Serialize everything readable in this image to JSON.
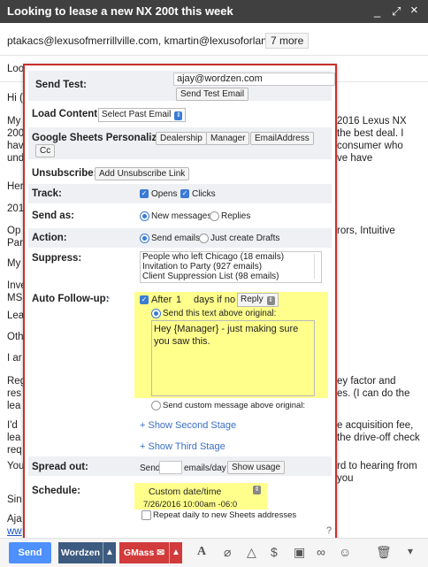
{
  "window": {
    "title": "Looking to lease a new NX 200t this week",
    "minimize": "_",
    "popout": "⤢",
    "close": "×"
  },
  "recipients": {
    "to": "ptakacs@lexusofmerrillville.com, kmartin@lexusoforland.com",
    "more": "7 more"
  },
  "subject_prefix": "Loo",
  "body_fragments": {
    "greeting": "Hi (",
    "p1a": "My",
    "p1b": "200",
    "p1c": "hav",
    "p1d": "und",
    "r1": "2016 Lexus NX",
    "r2": "the best deal. I",
    "r3": "consumer who",
    "r4": "ve have",
    "l1": "Her",
    "l2": "201",
    "l3": "Op",
    "l4": "Par",
    "r5": "rors, Intuitive",
    "l5": "My",
    "l6": "Inve",
    "l7": "MS",
    "l8": "Lea",
    "l9": "Oth",
    "l10": "I ar",
    "l11": "Reg",
    "l12": "res",
    "l13": "lea",
    "r6": "ey factor and",
    "r7": "es. (I can do the",
    "l14": "I'd",
    "l15": "lea",
    "l16": "req",
    "r8": "e acquisition fee,",
    "r9": "the drive-off check",
    "l17": "You",
    "l18": "Sin",
    "l19": "Aja",
    "l20": "ww",
    "r10": "rd to hearing from",
    "r11": "you"
  },
  "panel": {
    "send_test": {
      "label": "Send Test:",
      "email": "ajay@wordzen.com",
      "button": "Send Test Email"
    },
    "load_content": {
      "label": "Load Content:",
      "select": "Select Past Email"
    },
    "personalize": {
      "label": "Google Sheets Personalize:",
      "tags": [
        "Dealership",
        "Manager",
        "EmailAddress",
        "Cc"
      ]
    },
    "unsubscribe": {
      "label": "Unsubscribe:",
      "button": "Add Unsubscribe Link"
    },
    "track": {
      "label": "Track:",
      "opens": "Opens",
      "clicks": "Clicks"
    },
    "send_as": {
      "label": "Send as:",
      "new": "New messages",
      "replies": "Replies"
    },
    "action": {
      "label": "Action:",
      "send": "Send emails",
      "drafts": "Just create Drafts"
    },
    "suppress": {
      "label": "Suppress:",
      "items": [
        "People who left Chicago (18 emails)",
        "Invitation to Party (927 emails)",
        "Client Suppression List (98 emails)"
      ]
    },
    "followup": {
      "label": "Auto Follow-up:",
      "dash": "-",
      "after": "After",
      "days": "1",
      "days_label": "days if no",
      "condition": "Reply",
      "option1": "Send this text above original:",
      "text": "Hey {Manager} - just making sure you saw this.",
      "option2": "Send custom message above original:",
      "second": "+ Show Second Stage",
      "third": "+ Show Third Stage"
    },
    "spread": {
      "label": "Spread out:",
      "send": "Send",
      "unit": "emails/day",
      "button": "Show usage"
    },
    "schedule": {
      "label": "Schedule:",
      "select": "Custom date/time",
      "datetime": "7/26/2016 10:00am -06:0",
      "repeat": "Repeat daily to new Sheets addresses"
    },
    "help": "?"
  },
  "toolbar": {
    "send": "Send",
    "wordzen": "Wordzen",
    "gmass": "GMass"
  },
  "colors": {
    "accent": "#4d90fe",
    "panel_border": "#c9302c",
    "highlight": "#ffff8c",
    "wordzen": "#3d5a80",
    "gmass": "#d23b3b"
  }
}
